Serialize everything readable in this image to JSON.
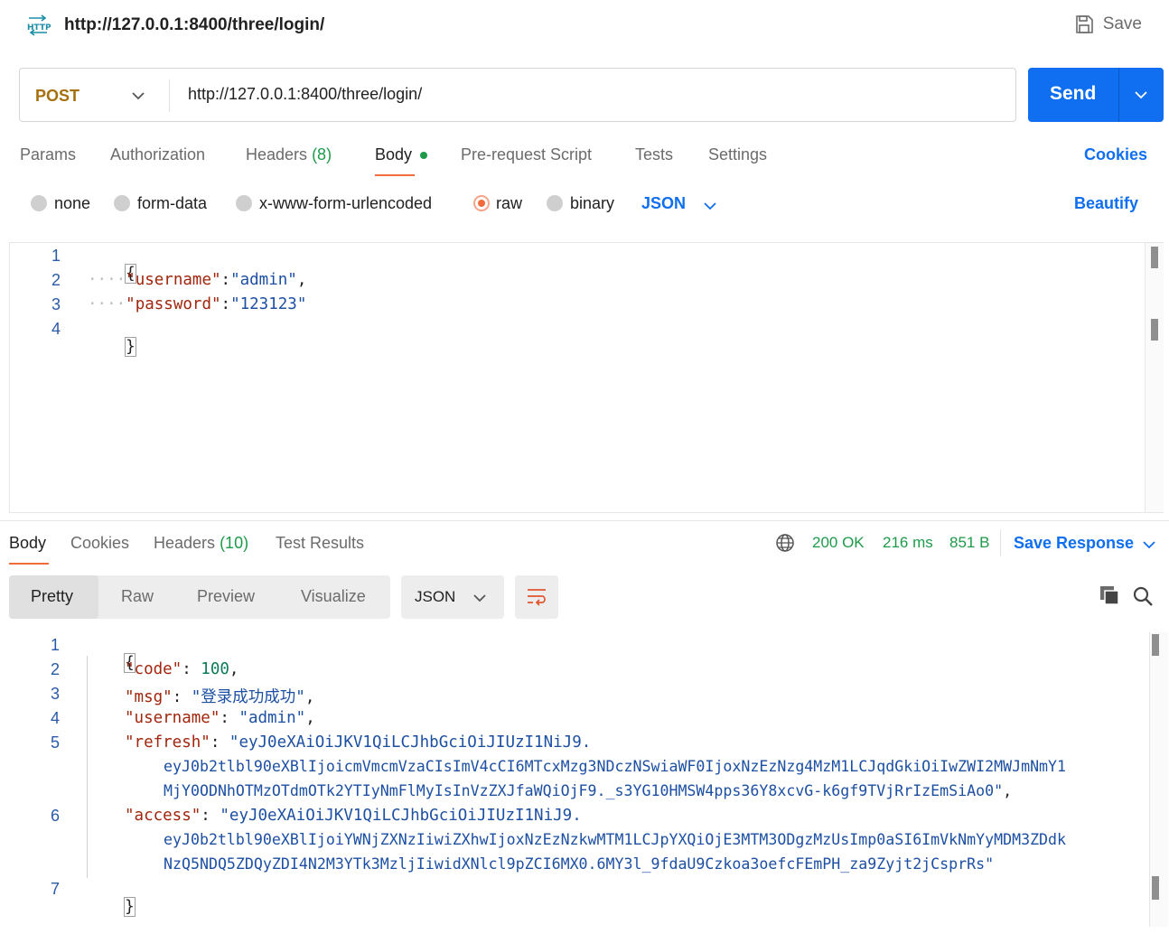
{
  "header": {
    "icon": "http-icon",
    "title": "http://127.0.0.1:8400/three/login/",
    "save_label": "Save"
  },
  "request": {
    "method": "POST",
    "url": "http://127.0.0.1:8400/three/login/",
    "send_label": "Send"
  },
  "tabs": {
    "params": "Params",
    "authorization": "Authorization",
    "headers": "Headers",
    "headers_count": "(8)",
    "body": "Body",
    "prerequest": "Pre-request Script",
    "tests": "Tests",
    "settings": "Settings",
    "cookies": "Cookies"
  },
  "body_types": {
    "none": "none",
    "form_data": "form-data",
    "urlencoded": "x-www-form-urlencoded",
    "raw": "raw",
    "binary": "binary",
    "selected": "raw",
    "format": "JSON",
    "beautify": "Beautify"
  },
  "request_body": {
    "line_numbers": [
      "1",
      "2",
      "3",
      "4"
    ],
    "open": "{",
    "close": "}",
    "indent": "····",
    "k_username": "\"username\"",
    "v_username": "\"admin\"",
    "k_password": "\"password\"",
    "v_password": "\"123123\""
  },
  "response": {
    "tabs": {
      "body": "Body",
      "cookies": "Cookies",
      "headers": "Headers",
      "headers_count": "(10)",
      "test_results": "Test Results"
    },
    "status": "200 OK",
    "time": "216 ms",
    "size": "851 B",
    "save_response": "Save Response",
    "views": {
      "pretty": "Pretty",
      "raw": "Raw",
      "preview": "Preview",
      "visualize": "Visualize"
    },
    "format": "JSON",
    "line_numbers": [
      "1",
      "2",
      "3",
      "4",
      "5",
      "6",
      "7"
    ],
    "open": "{",
    "close": "}",
    "k_code": "\"code\"",
    "v_code": "100",
    "k_msg": "\"msg\"",
    "v_msg": "\"登录成功成功\"",
    "k_username": "\"username\"",
    "v_username": "\"admin\"",
    "k_refresh": "\"refresh\"",
    "v_refresh_1": "\"eyJ0eXAiOiJKV1QiLCJhbGciOiJIUzI1NiJ9.",
    "v_refresh_2": "eyJ0b2tlbl90eXBlIjoicmVmcmVzaCIsImV4cCI6MTcxMzg3NDczNSwiaWF0IjoxNzEzNzg4MzM1LCJqdGkiOiIwZWI2MWJmNmY1",
    "v_refresh_3": "MjY0ODNhOTMzOTdmOTk2YTIyNmFlMyIsInVzZXJfaWQiOjF9._s3YG10HMSW4pps36Y8xcvG-k6gf9TVjRrIzEmSiAo0\"",
    "k_access": "\"access\"",
    "v_access_1": "\"eyJ0eXAiOiJKV1QiLCJhbGciOiJIUzI1NiJ9.",
    "v_access_2": "eyJ0b2tlbl90eXBlIjoiYWNjZXNzIiwiZXhwIjoxNzEzNzkwMTM1LCJpYXQiOjE3MTM3ODgzMzUsImp0aSI6ImVkNmYyMDM3ZDdk",
    "v_access_3": "NzQ5NDQ5ZDQyZDI4N2M3YTk3MzljIiwidXNlcl9pZCI6MX0.6MY3l_9fdaU9Czkoa3oefcFEmPH_za9Zyjt2jCsprRs\""
  },
  "colors": {
    "accent": "#0f6ff0",
    "tab_indicator": "#f26b3a",
    "status_ok": "#1f9a4a",
    "method_post": "#a5700c"
  }
}
